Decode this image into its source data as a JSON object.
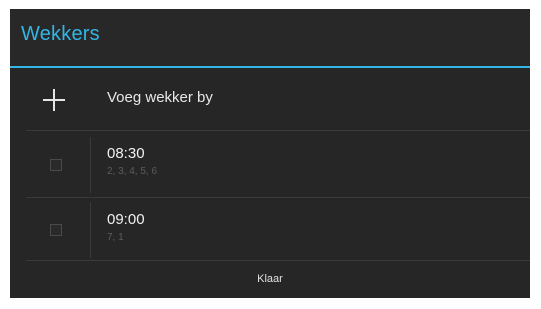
{
  "dialog": {
    "title": "Wekkers",
    "accent_color": "#33b5e5",
    "background_color": "#262626"
  },
  "add_alarm": {
    "icon": "plus-icon",
    "label": "Voeg wekker by"
  },
  "alarms": [
    {
      "time": "08:30",
      "days": "2, 3, 4, 5, 6",
      "enabled": false
    },
    {
      "time": "09:00",
      "days": "7, 1",
      "enabled": false
    }
  ],
  "footer": {
    "done_label": "Klaar"
  }
}
